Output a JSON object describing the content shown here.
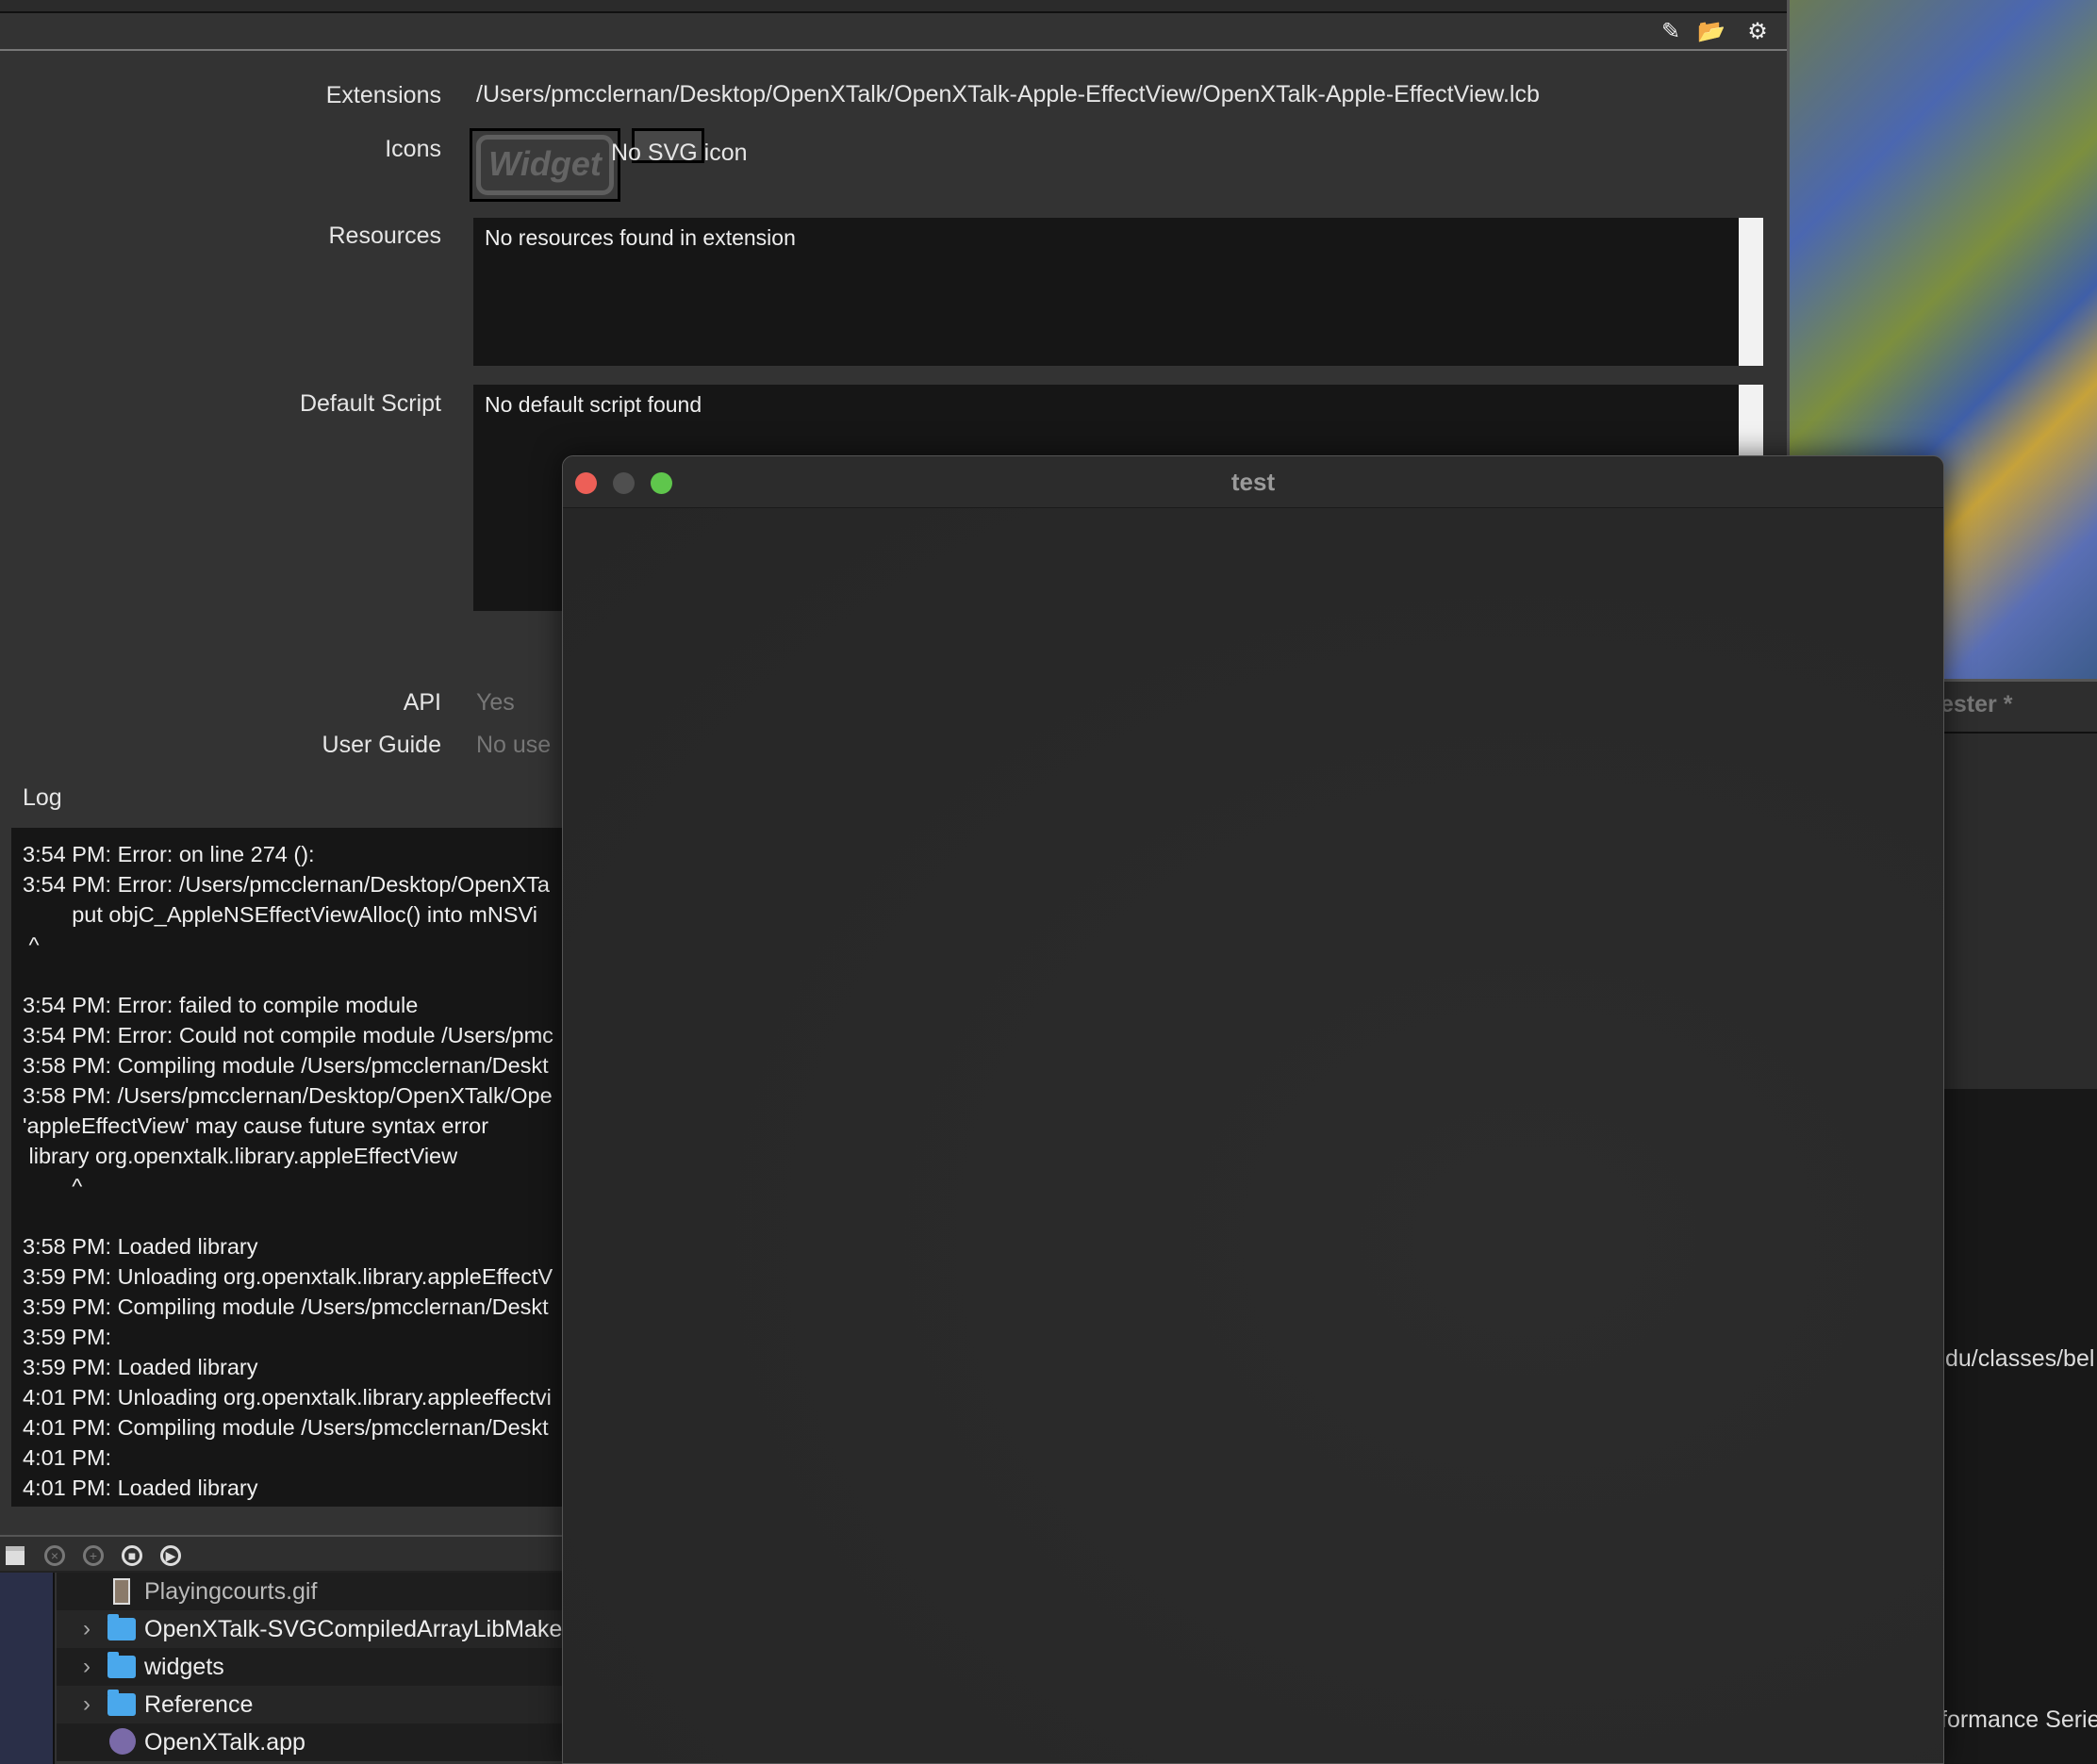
{
  "toolbar": {
    "icons": [
      "edit-script-icon",
      "folder-open-icon",
      "gear-icon"
    ]
  },
  "fields": {
    "extensions_label": "Extensions",
    "extensions_value": "/Users/pmcclernan/Desktop/OpenXTalk/OpenXTalk-Apple-EffectView/OpenXTalk-Apple-EffectView.lcb",
    "icons_label": "Icons",
    "icon_widget_text": "Widget",
    "icon_svg_text": "No SVG icon",
    "resources_label": "Resources",
    "resources_value": "No resources found in extension",
    "default_script_label": "Default Script",
    "default_script_value": "No default script found",
    "api_label": "API",
    "api_value": "Yes",
    "user_guide_label": "User Guide",
    "user_guide_value": "No use"
  },
  "log": {
    "label": "Log",
    "lines": [
      "3:54 PM: Error: on line 274 ():",
      "3:54 PM: Error: /Users/pmcclernan/Desktop/OpenXTa",
      "        put objC_AppleNSEffectViewAlloc() into mNSVi",
      " ^",
      "",
      "3:54 PM: Error: failed to compile module",
      "3:54 PM: Error: Could not compile module /Users/pmc",
      "3:58 PM: Compiling module /Users/pmcclernan/Deskt",
      "3:58 PM: /Users/pmcclernan/Desktop/OpenXTalk/Ope",
      "'appleEffectView' may cause future syntax error",
      " library org.openxtalk.library.appleEffectView",
      "        ^",
      "",
      "3:58 PM: Loaded library",
      "3:59 PM: Unloading org.openxtalk.library.appleEffectV",
      "3:59 PM: Compiling module /Users/pmcclernan/Deskt",
      "3:59 PM:",
      "3:59 PM: Loaded library",
      "4:01 PM: Unloading org.openxtalk.library.appleeffectvi",
      "4:01 PM: Compiling module /Users/pmcclernan/Deskt",
      "4:01 PM:",
      "4:01 PM: Loaded library"
    ]
  },
  "files": [
    {
      "name": "Playingcourts.gif",
      "type": "file",
      "expandable": false
    },
    {
      "name": "OpenXTalk-SVGCompiledArrayLibMake",
      "type": "folder",
      "expandable": true
    },
    {
      "name": "widgets",
      "type": "folder",
      "expandable": true
    },
    {
      "name": "Reference",
      "type": "folder",
      "expandable": true
    },
    {
      "name": "OpenXTalk.app",
      "type": "app",
      "expandable": false
    }
  ],
  "right_window": {
    "title_fragment": "ester *",
    "text1": "du/classes/bel",
    "text2": "formance Serie"
  },
  "test_window": {
    "title": "test",
    "colors": {
      "close": "#ed5f57",
      "minimize": "#4f4f4f",
      "zoom": "#5fc64c"
    }
  }
}
